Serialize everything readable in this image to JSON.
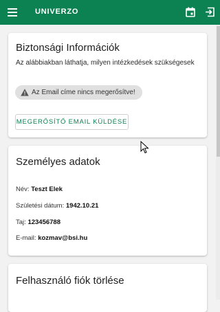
{
  "appbar": {
    "brand": "UNIVERZO",
    "icons": {
      "menu": "menu-icon",
      "calendar": "calendar-icon",
      "logout": "logout-icon"
    },
    "color": "#0c8253"
  },
  "security": {
    "title": "Biztonsági Információk",
    "subtitle": "Az alábbiakban láthatja, milyen intézkedések szükségesek",
    "warning": "Az Email címe nincs megerősítve!",
    "verify_button": "MEGERŐSÍTŐ EMAIL KÜLDÉSE"
  },
  "personal": {
    "title": "Személyes adatok",
    "name_label": "Név:",
    "name_value": "Teszt Elek",
    "birth_label": "Születési dátum:",
    "birth_value": "1942.10.21",
    "taj_label": "Taj:",
    "taj_value": "123456788",
    "email_label": "E-mail:",
    "email_value": "kozmav@bsi.hu"
  },
  "delete_account": {
    "title": "Felhasználó fiók törlése"
  }
}
